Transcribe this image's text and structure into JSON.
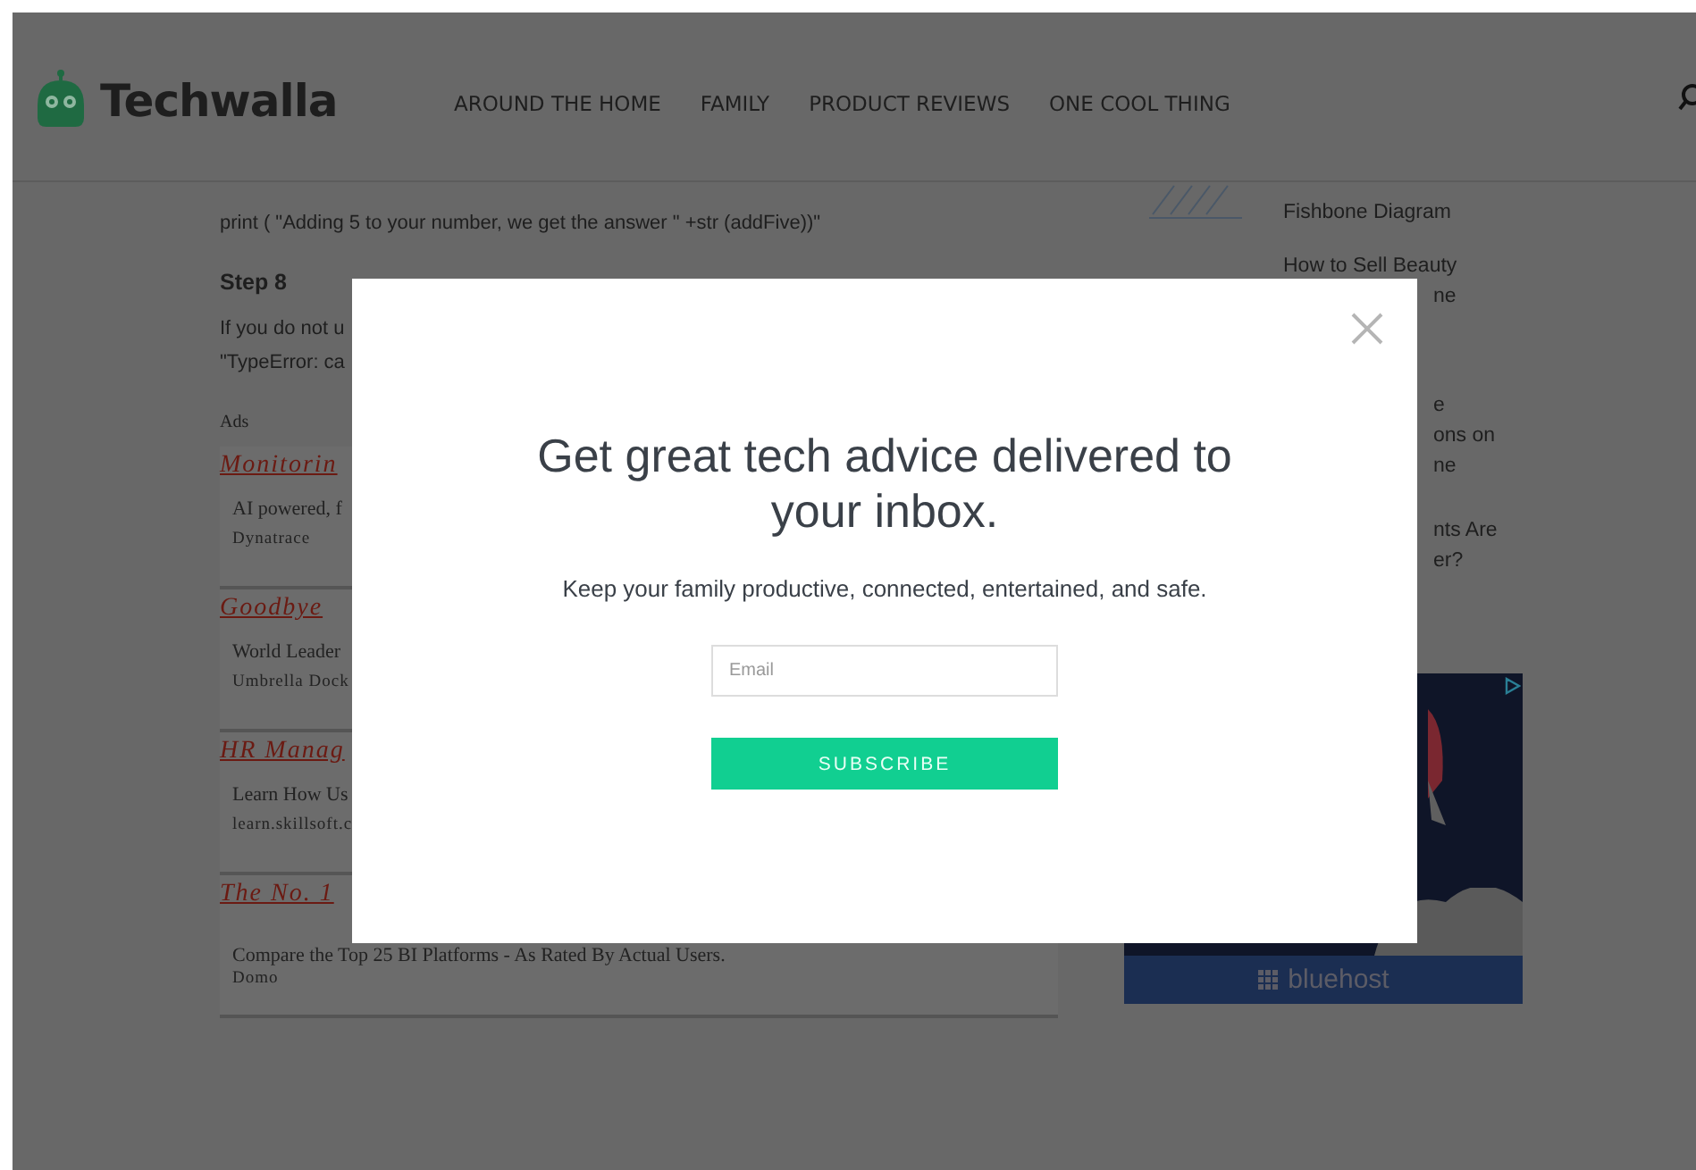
{
  "header": {
    "logo_text": "Techwalla",
    "nav": [
      "AROUND THE HOME",
      "FAMILY",
      "PRODUCT REVIEWS",
      "ONE COOL THING"
    ]
  },
  "article": {
    "code_line": "print ( \"Adding 5 to your number, we get the answer \" +str (addFive))\"",
    "step_heading": "Step 8",
    "lines": [
      "If you do not u",
      "\"TypeError: ca"
    ]
  },
  "ads": {
    "label": "Ads",
    "items": [
      {
        "title": "Monitorin",
        "description": "AI powered, f",
        "source": "Dynatrace"
      },
      {
        "title": "Goodbye",
        "description": "World Leader",
        "source": "Umbrella Dock"
      },
      {
        "title": "HR Manag",
        "description": "Learn How Us",
        "source": "learn.skillsoft.c"
      },
      {
        "title": "The No. 1",
        "description": "Compare the Top 25 BI Platforms - As Rated By Actual Users.",
        "source": "Domo"
      }
    ]
  },
  "sidebar": {
    "articles": [
      {
        "thumbnail": true,
        "lines": [
          {
            "text": "Fishbone Diagram",
            "covered": false
          }
        ]
      },
      {
        "thumbnail": false,
        "lines": [
          {
            "text": "How to Sell Beauty",
            "covered": false
          },
          {
            "text": "ne",
            "covered": true
          }
        ]
      },
      {
        "thumbnail": false,
        "lines": [
          {
            "text": "e",
            "covered": true
          },
          {
            "text": "ons on",
            "covered": true
          },
          {
            "text": "ne",
            "covered": true
          }
        ]
      },
      {
        "thumbnail": false,
        "lines": [
          {
            "text": "nts Are",
            "covered": true
          },
          {
            "text": "er?",
            "covered": true
          }
        ]
      }
    ],
    "ad_banner": {
      "brand": "bluehost"
    }
  },
  "modal": {
    "heading": "Get great tech advice delivered to your inbox.",
    "subtitle": "Keep your family productive, connected, entertained, and safe.",
    "email": {
      "placeholder": "Email"
    },
    "button": "SUBSCRIBE"
  }
}
